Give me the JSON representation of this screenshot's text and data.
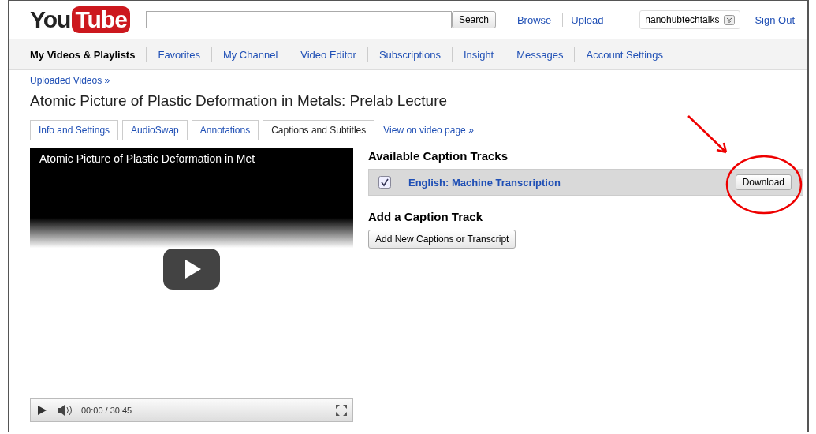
{
  "header": {
    "logo": {
      "you": "You",
      "tube": "Tube"
    },
    "search": {
      "button": "Search"
    },
    "links": [
      "Browse",
      "Upload"
    ],
    "account": "nanohubtechtalks",
    "sign_out": "Sign Out"
  },
  "nav": [
    {
      "label": "My Videos & Playlists",
      "selected": true
    },
    {
      "label": "Favorites",
      "selected": false
    },
    {
      "label": "My Channel",
      "selected": false
    },
    {
      "label": "Video Editor",
      "selected": false
    },
    {
      "label": "Subscriptions",
      "selected": false
    },
    {
      "label": "Insight",
      "selected": false
    },
    {
      "label": "Messages",
      "selected": false
    },
    {
      "label": "Account Settings",
      "selected": false
    }
  ],
  "breadcrumb": "Uploaded Videos »",
  "title": "Atomic Picture of Plastic Deformation in Metals: Prelab Lecture",
  "tabs": [
    {
      "label": "Info and Settings",
      "selected": false
    },
    {
      "label": "AudioSwap",
      "selected": false
    },
    {
      "label": "Annotations",
      "selected": false
    },
    {
      "label": "Captions and Subtitles",
      "selected": true
    }
  ],
  "view_link": "View on video page »",
  "player": {
    "overlay_title": "Atomic Picture of Plastic Deformation in Met",
    "time": "00:00 / 30:45"
  },
  "captions": {
    "heading": "Available Caption Tracks",
    "tracks": [
      {
        "name": "English: Machine Transcription",
        "checked": true,
        "button": "Download"
      }
    ],
    "add_heading": "Add a Caption Track",
    "add_button": "Add New Captions or Transcript"
  }
}
